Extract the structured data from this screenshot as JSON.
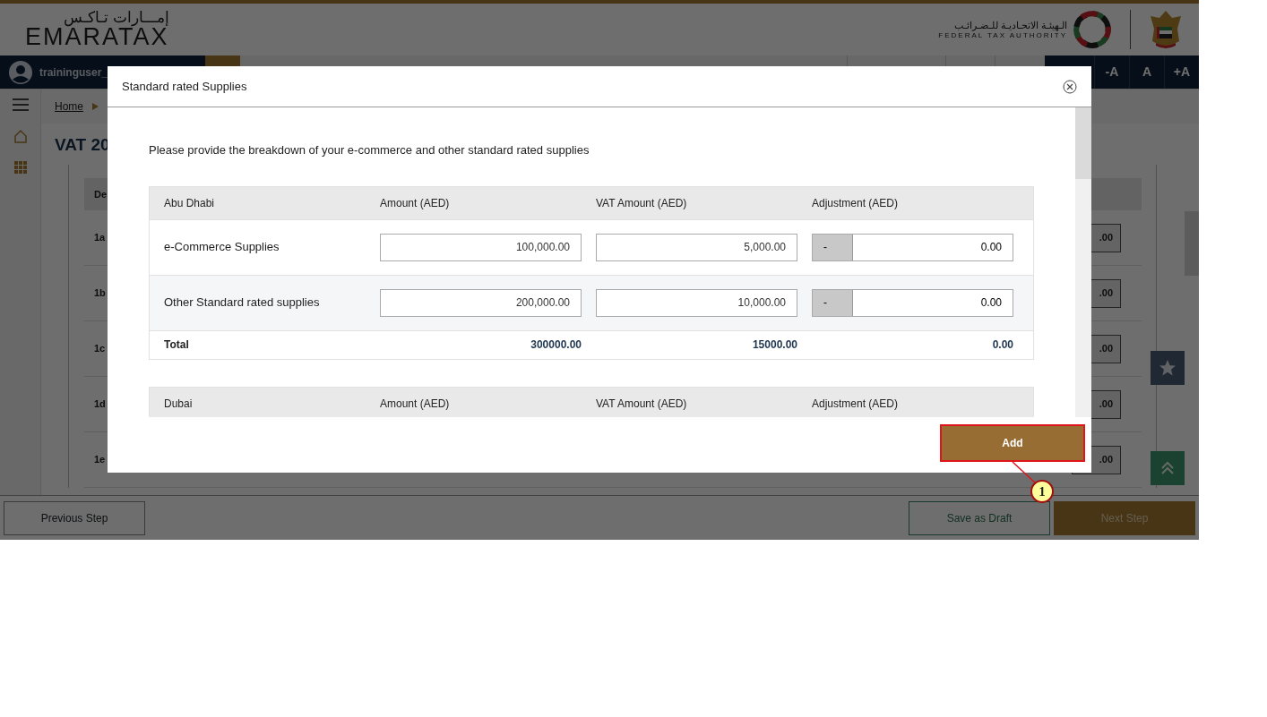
{
  "header": {
    "logo_arabic": "إمـــارات تـاكـس",
    "logo_text": "EMARATAX",
    "authority_arabic": "الـهيئـة الاتحـاديـة للـضـرائـب",
    "authority_english": "FEDERAL TAX AUTHORITY"
  },
  "topbar": {
    "username": "traininguser_",
    "font_buttons": [
      "-A",
      "A",
      "+A"
    ]
  },
  "breadcrumb": [
    "Home"
  ],
  "page_title": "VAT 20",
  "background_table": {
    "header": "De",
    "rows": [
      {
        "label": "1a",
        "value": ".00"
      },
      {
        "label": "1b",
        "value": ".00"
      },
      {
        "label": "1c",
        "value": ".00"
      },
      {
        "label": "1d",
        "value": ".00"
      },
      {
        "label": "1e",
        "value": ".00"
      }
    ]
  },
  "modal": {
    "title": "Standard rated Supplies",
    "intro": "Please provide the breakdown of your e-commerce and other standard rated supplies",
    "sections": [
      {
        "columns": [
          "Abu Dhabi",
          "Amount (AED)",
          "VAT Amount (AED)",
          "Adjustment (AED)"
        ],
        "rows": [
          {
            "label": "e-Commerce Supplies",
            "amount": "100,000.00",
            "vat": "5,000.00",
            "sign": "-",
            "adjustment": "0.00"
          },
          {
            "label": "Other Standard rated supplies",
            "amount": "200,000.00",
            "vat": "10,000.00",
            "sign": "-",
            "adjustment": "0.00"
          }
        ],
        "total": {
          "label": "Total",
          "amount": "300000.00",
          "vat": "15000.00",
          "adjustment": "0.00"
        }
      },
      {
        "columns": [
          "Dubai",
          "Amount (AED)",
          "VAT Amount (AED)",
          "Adjustment (AED)"
        ]
      }
    ],
    "add_button": "Add"
  },
  "annotation": {
    "number": "1"
  },
  "footer": {
    "previous": "Previous Step",
    "save": "Save as Draft",
    "next": "Next Step"
  }
}
